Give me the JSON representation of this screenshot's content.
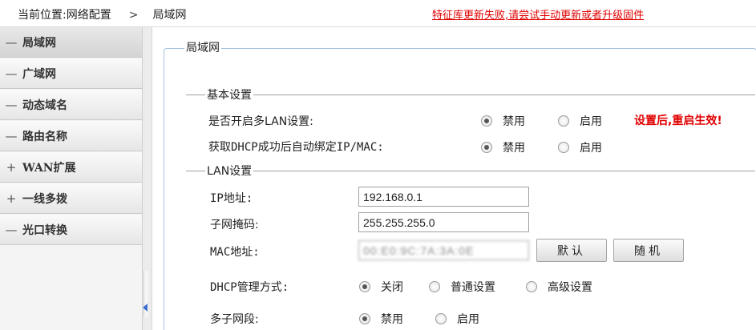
{
  "topbar": {
    "location_label": "当前位置:网络配置",
    "separator": ">",
    "current_page": "局域网",
    "alert_text": "特征库更新失败,请尝试手动更新或者升级固件"
  },
  "sidebar": {
    "items": [
      {
        "symbol": "—",
        "label": "局域网"
      },
      {
        "symbol": "—",
        "label": "广域网"
      },
      {
        "symbol": "—",
        "label": "动态域名"
      },
      {
        "symbol": "—",
        "label": "路由名称"
      },
      {
        "symbol": "+",
        "label": "WAN扩展"
      },
      {
        "symbol": "+",
        "label": "一线多拨"
      },
      {
        "symbol": "—",
        "label": "光口转换"
      }
    ]
  },
  "main": {
    "panel_title": "局域网",
    "basic": {
      "title": "基本设置",
      "multi_lan_label": "是否开启多LAN设置:",
      "multi_lan_disable": "禁用",
      "multi_lan_enable": "启用",
      "restart_note": "设置后,重启生效!",
      "auto_bind_label": "获取DHCP成功后自动绑定IP/MAC:",
      "auto_bind_disable": "禁用",
      "auto_bind_enable": "启用"
    },
    "lan": {
      "title": "LAN设置",
      "ip_label": "IP地址:",
      "ip_value": "192.168.0.1",
      "mask_label": "子网掩码:",
      "mask_value": "255.255.255.0",
      "mac_label": "MAC地址:",
      "mac_value": "00:E0:9C:7A:3A:0E",
      "default_button": "默认",
      "random_button": "随机",
      "dhcp_label": "DHCP管理方式:",
      "dhcp_off": "关闭",
      "dhcp_normal": "普通设置",
      "dhcp_advanced": "高级设置",
      "multi_subnet_label": "多子网段:",
      "multi_subnet_disable": "禁用",
      "multi_subnet_enable": "启用"
    }
  },
  "colors": {
    "alert": "#e00000",
    "panel_border": "#a8c0de",
    "splitter_arrow": "#3a6fd1"
  }
}
